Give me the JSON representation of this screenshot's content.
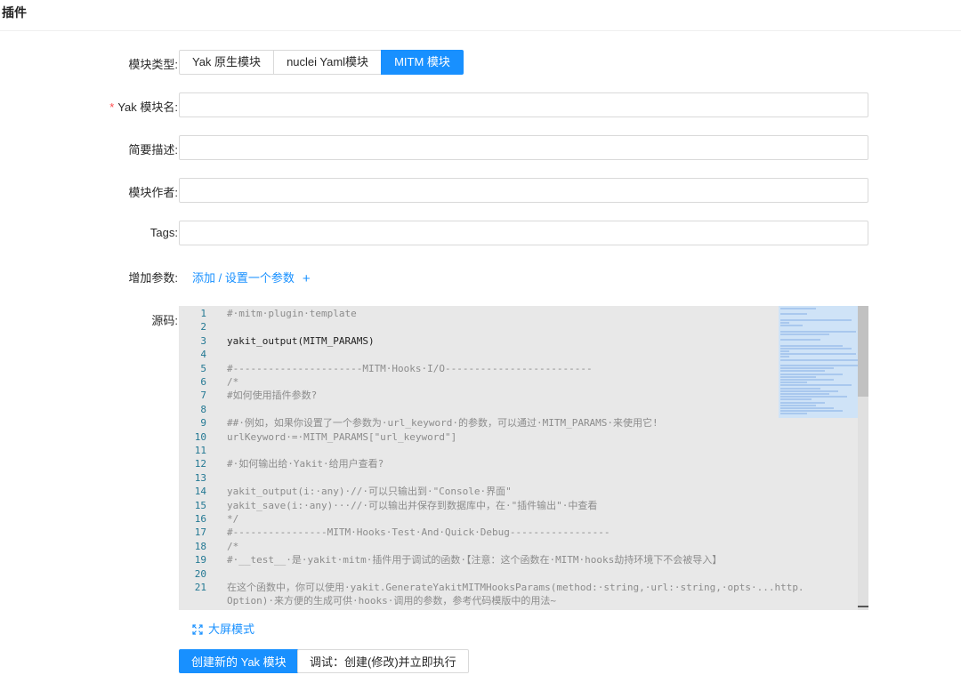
{
  "header": {
    "title": "插件"
  },
  "form": {
    "module_type": {
      "label": "模块类型",
      "options": [
        "Yak 原生模块",
        "nuclei Yaml模块",
        "MITM 模块"
      ],
      "selected": "MITM 模块"
    },
    "module_name": {
      "label": "Yak 模块名",
      "required_mark": "*",
      "value": ""
    },
    "description": {
      "label": "简要描述",
      "value": ""
    },
    "author": {
      "label": "模块作者",
      "value": ""
    },
    "tags": {
      "label": "Tags",
      "value": ""
    },
    "params": {
      "label": "增加参数",
      "add_link": "添加 / 设置一个参数",
      "add_icon": "plus-icon"
    },
    "source": {
      "label": "源码",
      "lines": [
        {
          "n": "1",
          "text": "#·mitm·plugin·template",
          "dark": false
        },
        {
          "n": "2",
          "text": "",
          "dark": false
        },
        {
          "n": "3",
          "text": "yakit_output(MITM_PARAMS)",
          "dark": true
        },
        {
          "n": "4",
          "text": "",
          "dark": false
        },
        {
          "n": "5",
          "text": "#----------------------MITM·Hooks·I/O-------------------------",
          "dark": false
        },
        {
          "n": "6",
          "text": "/*",
          "dark": false
        },
        {
          "n": "7",
          "text": "#如何使用插件参数?",
          "dark": false
        },
        {
          "n": "8",
          "text": "",
          "dark": false
        },
        {
          "n": "9",
          "text": "##·例如，如果你设置了一个参数为·url_keyword·的参数，可以通过·MITM_PARAMS·来使用它!",
          "dark": false
        },
        {
          "n": "10",
          "text": "urlKeyword·=·MITM_PARAMS[\"url_keyword\"]",
          "dark": false
        },
        {
          "n": "11",
          "text": "",
          "dark": false
        },
        {
          "n": "12",
          "text": "#·如何输出给·Yakit·给用户查看?",
          "dark": false
        },
        {
          "n": "13",
          "text": "",
          "dark": false
        },
        {
          "n": "14",
          "text": "yakit_output(i:·any)·//·可以只输出到·\"Console·界面\"",
          "dark": false
        },
        {
          "n": "15",
          "text": "yakit_save(i:·any)···//·可以输出并保存到数据库中，在·\"插件输出\"·中查看",
          "dark": false
        },
        {
          "n": "16",
          "text": "*/",
          "dark": false
        },
        {
          "n": "17",
          "text": "#----------------MITM·Hooks·Test·And·Quick·Debug-----------------",
          "dark": false
        },
        {
          "n": "18",
          "text": "/*",
          "dark": false
        },
        {
          "n": "19",
          "text": "#·__test__·是·yakit·mitm·插件用于调试的函数·【注意：这个函数在·MITM·hooks劫持环境下不会被导入】",
          "dark": false
        },
        {
          "n": "20",
          "text": "",
          "dark": false
        },
        {
          "n": "21",
          "text": "在这个函数中，你可以使用·yakit.GenerateYakitMITMHooksParams(method:·string,·url:·string,·opts·...http.",
          "dark": false
        },
        {
          "n": "",
          "text": "Option)·来方便的生成可供·hooks·调用的参数，参考代码模版中的用法~",
          "dark": false
        }
      ]
    },
    "fullscreen": {
      "label": "大屏模式",
      "icon": "expand-icon"
    },
    "submit_label": "创建新的 Yak 模块",
    "debug_label": "调试：创建(修改)并立即执行"
  },
  "colors": {
    "primary": "#1890ff",
    "required": "#ff4d4f",
    "editor_bg": "#e8e8e8"
  }
}
